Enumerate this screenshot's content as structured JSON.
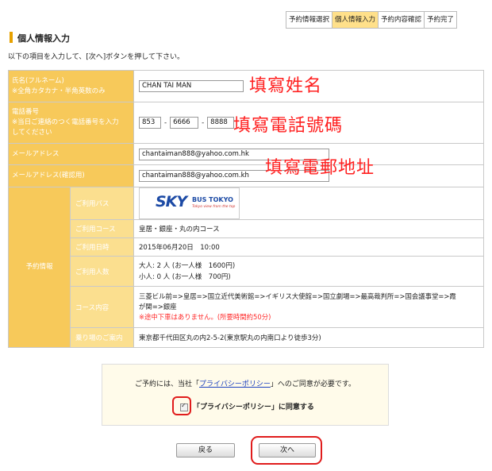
{
  "steps": [
    "予約情報選択",
    "個人情報入力",
    "予約内容確認",
    "予約完了"
  ],
  "page_title": "個人情報入力",
  "instruction": "以下の項目を入力して、[次へ]ボタンを押して下さい。",
  "form": {
    "name_label_1": "氏名(フルネーム)",
    "name_label_2": "※全角カタカナ・半角英数のみ",
    "name_value": "CHAN TAI MAN",
    "phone_label_1": "電話番号",
    "phone_label_2": "※当日ご連絡のつく電話番号を入力",
    "phone_label_3": "してください",
    "phone_1": "853",
    "phone_2": "6666",
    "phone_3": "8888",
    "email_label": "メールアドレス",
    "email_value": "chantaiman888@yahoo.com.hk",
    "email_confirm_label": "メールアドレス(確認用)",
    "email_confirm_value": "chantaiman888@yahoo.com.kh",
    "dash": "-"
  },
  "annotations": {
    "name": "填寫姓名",
    "phone": "填寫電話號碼",
    "email": "填寫電郵地址"
  },
  "booking": {
    "group_label": "予約情報",
    "bus_label": "ご利用バス",
    "logo_sky": "SKY",
    "logo_bus": "BUS TOKYO",
    "logo_tagline": "Tokyo view from the top",
    "course_label": "ご利用コース",
    "course_value": "皇居・銀座・丸の内コース",
    "date_label": "ご利用日時",
    "date_value": "2015年06月20日　10:00",
    "people_label": "ご利用人数",
    "adult_value": "大人: 2 人 (お一人様　1600円)",
    "child_value": "小人: 0 人 (お一人様　700円)",
    "content_label": "コース内容",
    "content_line1": "三菱ビル前=>皇居=>国立近代美術館=>イギリス大使館=>国立劇場=>最高裁判所=>国会議事堂=>霞",
    "content_line2": "が関=>銀座",
    "content_note": "※途中下車はありません。(所要時間約50分)",
    "boarding_label": "乗り場のご案内",
    "boarding_value": "東京都千代田区丸の内2-5-2(東京駅丸の内南口より徒歩3分)"
  },
  "privacy": {
    "text_before": "ご予約には、当社「",
    "link": "プライバシーポリシー",
    "text_after": "」へのご同意が必要です。",
    "agree_label": "「プライバシーポリシー」に同意する",
    "checked": true
  },
  "buttons": {
    "back": "戻る",
    "next": "次へ"
  },
  "colors": {
    "label_bg": "#f7c95a",
    "sub_label_bg": "#fbdf8f",
    "active_step": "#ffe08a",
    "annotation": "#ff2020",
    "note_red": "#ff2a2a"
  }
}
